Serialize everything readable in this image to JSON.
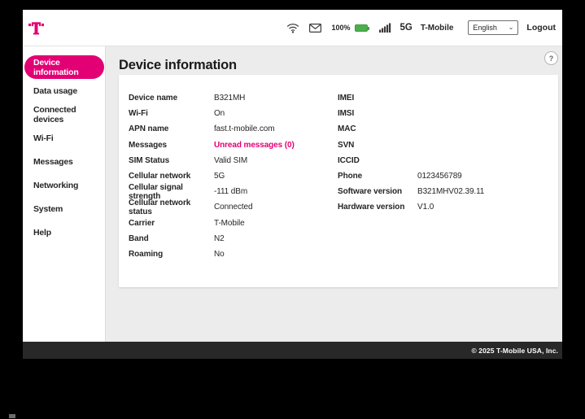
{
  "header": {
    "battery_percent": "100%",
    "network_badge": "5G",
    "carrier": "T-Mobile",
    "language_selector": {
      "value": "English"
    },
    "logout_label": "Logout",
    "icons": [
      "wifi-icon",
      "envelope-icon",
      "battery-icon",
      "signal-bars-icon"
    ]
  },
  "sidebar": {
    "items": [
      {
        "label": "Device information",
        "selected": true
      },
      {
        "label": "Data usage",
        "selected": false
      },
      {
        "label": "Connected devices",
        "selected": false
      },
      {
        "label": "Wi-Fi",
        "selected": false
      },
      {
        "label": "Messages",
        "selected": false
      },
      {
        "label": "Networking",
        "selected": false
      },
      {
        "label": "System",
        "selected": false
      },
      {
        "label": "Help",
        "selected": false
      }
    ]
  },
  "main": {
    "title": "Device information",
    "help_button": "?",
    "info_left": [
      {
        "label": "Device name",
        "value": "B321MH",
        "accent": false
      },
      {
        "label": "Wi-Fi",
        "value": "On",
        "accent": false
      },
      {
        "label": "APN name",
        "value": "fast.t-mobile.com",
        "accent": false
      },
      {
        "label": "Messages",
        "value": "Unread messages (0)",
        "accent": true
      },
      {
        "label": "SIM Status",
        "value": "Valid SIM",
        "accent": false
      },
      {
        "label": "Cellular network",
        "value": "5G",
        "accent": false
      },
      {
        "label": "Cellular signal strength",
        "value": "-111 dBm",
        "accent": false
      },
      {
        "label": "Cellular network status",
        "value": "Connected",
        "accent": false
      },
      {
        "label": "Carrier",
        "value": "T-Mobile",
        "accent": false
      },
      {
        "label": "Band",
        "value": "N2",
        "accent": false
      },
      {
        "label": "Roaming",
        "value": "No",
        "accent": false
      }
    ],
    "info_right": [
      {
        "label": "IMEI",
        "value": "",
        "accent": false
      },
      {
        "label": "IMSI",
        "value": "",
        "accent": false
      },
      {
        "label": "MAC",
        "value": "",
        "accent": false
      },
      {
        "label": "SVN",
        "value": "",
        "accent": false
      },
      {
        "label": "ICCID",
        "value": "",
        "accent": false
      },
      {
        "label": "Phone",
        "value": "0123456789",
        "accent": false
      },
      {
        "label": "Software version",
        "value": "B321MHV02.39.11",
        "accent": false
      },
      {
        "label": "Hardware version",
        "value": "V1.0",
        "accent": false
      }
    ]
  },
  "footer": {
    "copyright": "© 2025 T-Mobile USA, Inc."
  },
  "colors": {
    "brand": "#E20074",
    "battery_green": "#4CAE4C",
    "footer_bg": "#282828"
  }
}
